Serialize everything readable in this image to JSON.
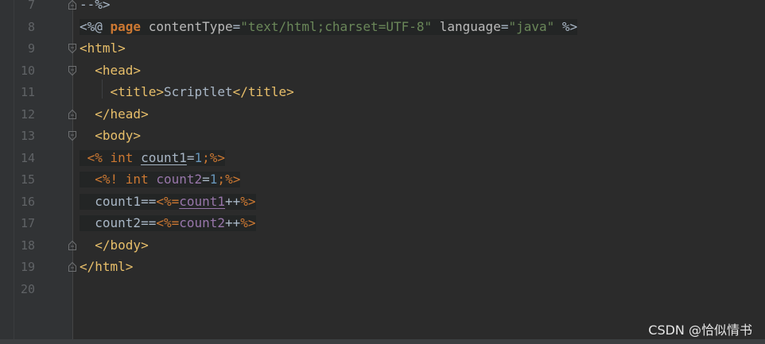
{
  "editor": {
    "lines": [
      {
        "number": "7",
        "tokens": [
          {
            "t": "--%>",
            "c": "t-text"
          }
        ]
      },
      {
        "number": "8",
        "tokens": [
          {
            "t": "<%@ ",
            "c": "t-text"
          },
          {
            "t": "page",
            "c": "t-kwb"
          },
          {
            "t": " contentType",
            "c": "t-attr"
          },
          {
            "t": "=",
            "c": "t-text"
          },
          {
            "t": "\"text/html;charset=UTF-8\"",
            "c": "t-str"
          },
          {
            "t": " language",
            "c": "t-attr"
          },
          {
            "t": "=",
            "c": "t-text"
          },
          {
            "t": "\"java\"",
            "c": "t-str"
          },
          {
            "t": " %>",
            "c": "t-text"
          }
        ]
      },
      {
        "number": "9",
        "tokens": [
          {
            "t": "<html>",
            "c": "t-tag"
          }
        ]
      },
      {
        "number": "10",
        "tokens": [
          {
            "t": "  <head>",
            "c": "t-tag"
          }
        ]
      },
      {
        "number": "11",
        "tokens": [
          {
            "t": "    <title>",
            "c": "t-tag"
          },
          {
            "t": "Scriptlet",
            "c": "t-text"
          },
          {
            "t": "</title>",
            "c": "t-tag"
          }
        ]
      },
      {
        "number": "12",
        "tokens": [
          {
            "t": "  </head>",
            "c": "t-tag"
          }
        ]
      },
      {
        "number": "13",
        "tokens": [
          {
            "t": "  <body>",
            "c": "t-tag"
          }
        ]
      },
      {
        "number": "14",
        "tokens": [
          {
            "t": " <% ",
            "c": "t-kw"
          },
          {
            "t": "int",
            "c": "t-kw"
          },
          {
            "t": " ",
            "c": "t-text"
          },
          {
            "t": "count1",
            "c": "t-uvar"
          },
          {
            "t": "=",
            "c": "t-text"
          },
          {
            "t": "1",
            "c": "t-num"
          },
          {
            "t": ";",
            "c": "t-kw"
          },
          {
            "t": "%>",
            "c": "t-kw"
          }
        ]
      },
      {
        "number": "15",
        "tokens": [
          {
            "t": "  <%! ",
            "c": "t-kw"
          },
          {
            "t": "int",
            "c": "t-kw"
          },
          {
            "t": " ",
            "c": "t-text"
          },
          {
            "t": "count2",
            "c": "t-var"
          },
          {
            "t": "=",
            "c": "t-text"
          },
          {
            "t": "1",
            "c": "t-num"
          },
          {
            "t": ";",
            "c": "t-kw"
          },
          {
            "t": "%>",
            "c": "t-kw"
          }
        ]
      },
      {
        "number": "16",
        "tokens": [
          {
            "t": "  count1==",
            "c": "t-text"
          },
          {
            "t": "<%=",
            "c": "t-kw"
          },
          {
            "t": "count1",
            "c": "t-uvar2"
          },
          {
            "t": "++",
            "c": "t-op"
          },
          {
            "t": "%>",
            "c": "t-kw"
          }
        ]
      },
      {
        "number": "17",
        "tokens": [
          {
            "t": "  count2==",
            "c": "t-text"
          },
          {
            "t": "<%=",
            "c": "t-kw"
          },
          {
            "t": "count2",
            "c": "t-var"
          },
          {
            "t": "++",
            "c": "t-op"
          },
          {
            "t": "%>",
            "c": "t-kw"
          }
        ]
      },
      {
        "number": "18",
        "tokens": [
          {
            "t": "  </body>",
            "c": "t-tag"
          }
        ]
      },
      {
        "number": "19",
        "tokens": [
          {
            "t": "</html>",
            "c": "t-tag"
          }
        ]
      },
      {
        "number": "20",
        "tokens": []
      }
    ],
    "fold_markers": {
      "7": "fold-end",
      "9": "fold-start",
      "10": "fold-start",
      "12": "fold-end",
      "13": "fold-start",
      "18": "fold-end",
      "19": "fold-end"
    },
    "highlighted_lines": [
      "8",
      "14",
      "15",
      "16",
      "17"
    ]
  },
  "watermark": "CSDN @恰似情书",
  "colors": {
    "background": "#2b2b2b",
    "gutter": "#313335",
    "tag": "#e8bf6a",
    "keyword": "#cc7832",
    "string": "#6a8759",
    "number": "#6897bb",
    "variable": "#9876aa",
    "text": "#a9b7c6"
  }
}
